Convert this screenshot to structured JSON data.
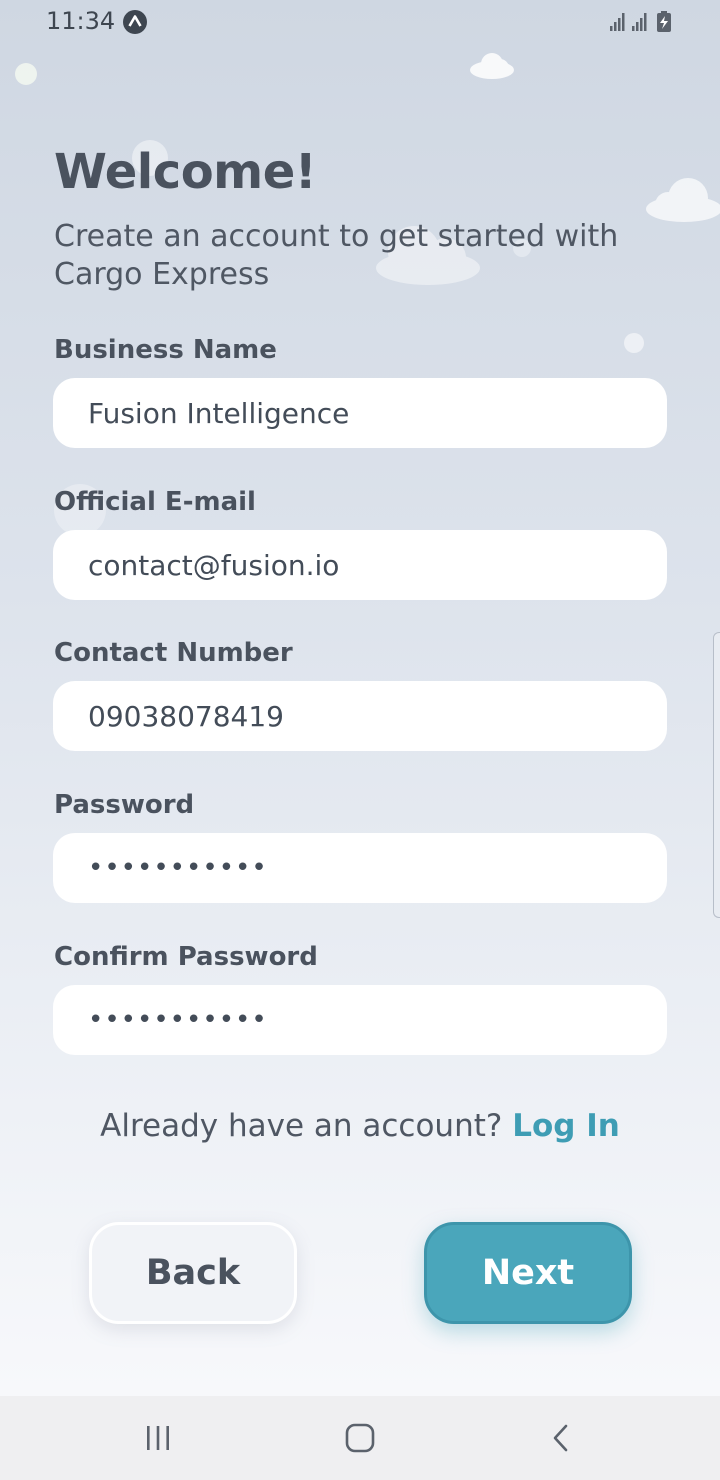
{
  "status_bar": {
    "time": "11:34",
    "app_icon": "caret-up-circle-icon",
    "icons": [
      "signal-icon",
      "signal-icon",
      "battery-charging-icon"
    ]
  },
  "header": {
    "title": "Welcome!",
    "subtitle": "Create an account to get started with Cargo Express"
  },
  "form": {
    "business_name": {
      "label": "Business Name",
      "value": "Fusion Intelligence"
    },
    "email": {
      "label": "Official E-mail",
      "value": "contact@fusion.io"
    },
    "contact_number": {
      "label": "Contact Number",
      "value": "09038078419"
    },
    "password": {
      "label": "Password",
      "value": "•••••••••••"
    },
    "confirm_password": {
      "label": "Confirm Password",
      "value": "•••••••••••"
    }
  },
  "login": {
    "prompt": "Already have an account?",
    "link": "Log In"
  },
  "buttons": {
    "back": "Back",
    "next": "Next"
  },
  "nav_bar": {
    "icons": [
      "recent-apps-icon",
      "home-icon",
      "back-icon"
    ]
  },
  "colors": {
    "accent": "#4aa6bb",
    "link": "#3e9db4",
    "text": "#4a525e",
    "field_bg": "#ffffff"
  }
}
